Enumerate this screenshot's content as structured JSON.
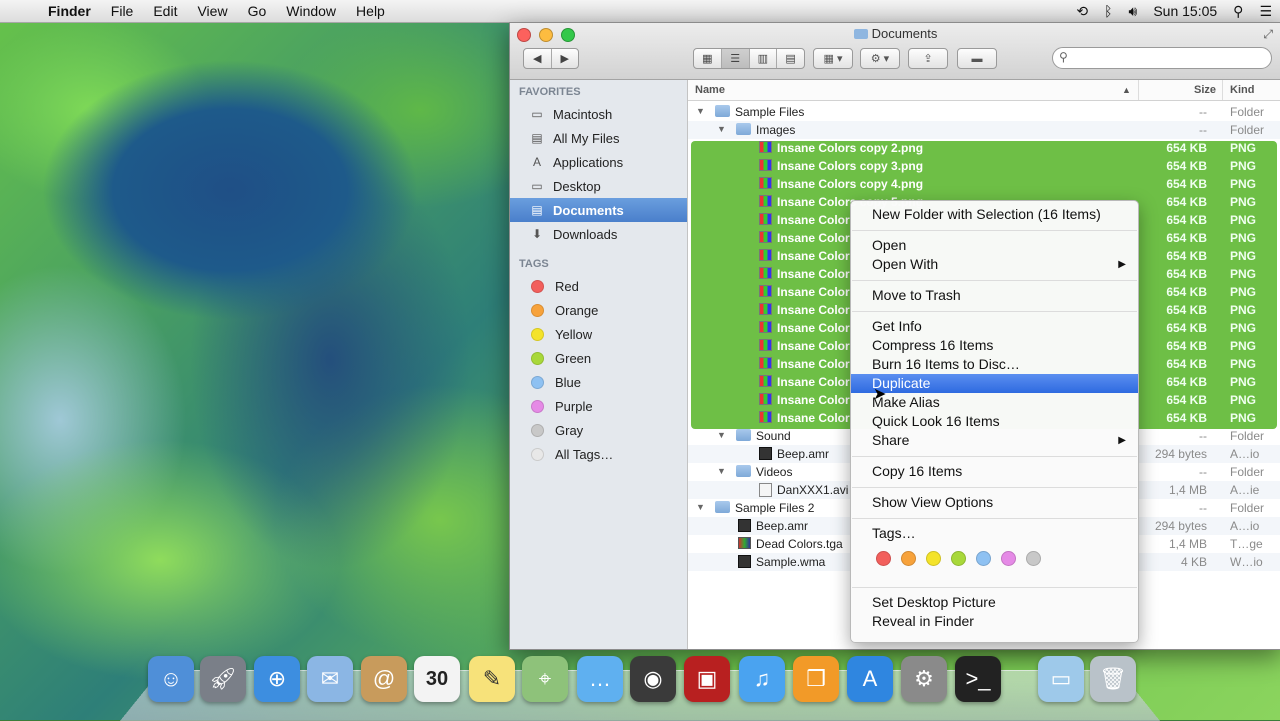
{
  "menubar": {
    "app": "Finder",
    "items": [
      "File",
      "Edit",
      "View",
      "Go",
      "Window",
      "Help"
    ],
    "clock": "Sun 15:05"
  },
  "window": {
    "title": "Documents"
  },
  "sidebar": {
    "favorites_heading": "FAVORITES",
    "favorites": [
      {
        "label": "Macintosh",
        "icon": "hard-drive-icon"
      },
      {
        "label": "All My Files",
        "icon": "all-files-icon"
      },
      {
        "label": "Applications",
        "icon": "applications-icon"
      },
      {
        "label": "Desktop",
        "icon": "desktop-icon"
      },
      {
        "label": "Documents",
        "icon": "documents-icon",
        "selected": true
      },
      {
        "label": "Downloads",
        "icon": "downloads-icon"
      }
    ],
    "tags_heading": "TAGS",
    "tags": [
      {
        "label": "Red",
        "color": "#f25f5c"
      },
      {
        "label": "Orange",
        "color": "#f7a23b"
      },
      {
        "label": "Yellow",
        "color": "#f4e32a"
      },
      {
        "label": "Green",
        "color": "#a8d83a"
      },
      {
        "label": "Blue",
        "color": "#8ec1f2"
      },
      {
        "label": "Purple",
        "color": "#e58ae6"
      },
      {
        "label": "Gray",
        "color": "#c8c8c8"
      },
      {
        "label": "All Tags…",
        "color": "#e8e8e8"
      }
    ]
  },
  "list": {
    "headers": {
      "name": "Name",
      "size": "Size",
      "kind": "Kind"
    },
    "rows": [
      {
        "name": "Sample Files",
        "size": "--",
        "kind": "Folder",
        "type": "folder",
        "level": 0,
        "expanded": true
      },
      {
        "name": "Images",
        "size": "--",
        "kind": "Folder",
        "type": "folder",
        "level": 1,
        "expanded": true
      },
      {
        "name": "Insane Colors copy 2.png",
        "size": "654 KB",
        "kind": "PNG",
        "type": "png",
        "level": 2,
        "selected": true
      },
      {
        "name": "Insane Colors copy 3.png",
        "size": "654 KB",
        "kind": "PNG",
        "type": "png",
        "level": 2,
        "selected": true
      },
      {
        "name": "Insane Colors copy 4.png",
        "size": "654 KB",
        "kind": "PNG",
        "type": "png",
        "level": 2,
        "selected": true
      },
      {
        "name": "Insane Colors copy 5.png",
        "size": "654 KB",
        "kind": "PNG",
        "type": "png",
        "level": 2,
        "selected": true
      },
      {
        "name": "Insane Color",
        "size": "654 KB",
        "kind": "PNG",
        "type": "png",
        "level": 2,
        "selected": true
      },
      {
        "name": "Insane Color",
        "size": "654 KB",
        "kind": "PNG",
        "type": "png",
        "level": 2,
        "selected": true
      },
      {
        "name": "Insane Color",
        "size": "654 KB",
        "kind": "PNG",
        "type": "png",
        "level": 2,
        "selected": true
      },
      {
        "name": "Insane Color",
        "size": "654 KB",
        "kind": "PNG",
        "type": "png",
        "level": 2,
        "selected": true
      },
      {
        "name": "Insane Color",
        "size": "654 KB",
        "kind": "PNG",
        "type": "png",
        "level": 2,
        "selected": true
      },
      {
        "name": "Insane Color",
        "size": "654 KB",
        "kind": "PNG",
        "type": "png",
        "level": 2,
        "selected": true
      },
      {
        "name": "Insane Color",
        "size": "654 KB",
        "kind": "PNG",
        "type": "png",
        "level": 2,
        "selected": true
      },
      {
        "name": "Insane Color",
        "size": "654 KB",
        "kind": "PNG",
        "type": "png",
        "level": 2,
        "selected": true
      },
      {
        "name": "Insane Color",
        "size": "654 KB",
        "kind": "PNG",
        "type": "png",
        "level": 2,
        "selected": true
      },
      {
        "name": "Insane Color",
        "size": "654 KB",
        "kind": "PNG",
        "type": "png",
        "level": 2,
        "selected": true
      },
      {
        "name": "Insane Color",
        "size": "654 KB",
        "kind": "PNG",
        "type": "png",
        "level": 2,
        "selected": true
      },
      {
        "name": "Insane Color",
        "size": "654 KB",
        "kind": "PNG",
        "type": "png",
        "level": 2,
        "selected": true
      },
      {
        "name": "Sound",
        "size": "--",
        "kind": "Folder",
        "type": "folder",
        "level": 1,
        "expanded": true
      },
      {
        "name": "Beep.amr",
        "size": "294 bytes",
        "kind": "A…io",
        "type": "snd",
        "level": 2
      },
      {
        "name": "Videos",
        "size": "--",
        "kind": "Folder",
        "type": "folder",
        "level": 1,
        "expanded": true
      },
      {
        "name": "DanXXX1.avi",
        "size": "1,4 MB",
        "kind": "A…ie",
        "type": "vid",
        "level": 2
      },
      {
        "name": "Sample Files 2",
        "size": "--",
        "kind": "Folder",
        "type": "folder",
        "level": 0,
        "expanded": true
      },
      {
        "name": "Beep.amr",
        "size": "294 bytes",
        "kind": "A…io",
        "type": "snd",
        "level": 1
      },
      {
        "name": "Dead Colors.tga",
        "size": "1,4 MB",
        "kind": "T…ge",
        "type": "tga",
        "level": 1
      },
      {
        "name": "Sample.wma",
        "size": "4 KB",
        "kind": "W…io",
        "type": "snd",
        "level": 1
      }
    ]
  },
  "context_menu": {
    "groups": [
      [
        "New Folder with Selection (16 Items)"
      ],
      [
        "Open",
        "Open With"
      ],
      [
        "Move to Trash"
      ],
      [
        "Get Info",
        "Compress 16 Items",
        "Burn 16 Items to Disc…",
        "Duplicate",
        "Make Alias",
        "Quick Look 16 Items",
        "Share"
      ],
      [
        "Copy 16 Items"
      ],
      [
        "Show View Options"
      ],
      [
        "Tags…"
      ],
      [
        "Set Desktop Picture",
        "Reveal in Finder"
      ]
    ],
    "highlighted": "Duplicate",
    "submenu_items": [
      "Open With",
      "Share"
    ],
    "tag_colors": [
      "#f25f5c",
      "#f7a23b",
      "#f4e32a",
      "#a8d83a",
      "#8ec1f2",
      "#e58ae6",
      "#c8c8c8"
    ]
  },
  "dock": {
    "apps": [
      {
        "name": "finder-icon",
        "color": "#4f8fd8"
      },
      {
        "name": "launchpad-icon",
        "color": "#7a7f88"
      },
      {
        "name": "safari-icon",
        "color": "#3d8ee0"
      },
      {
        "name": "mail-icon",
        "color": "#8bb6e4"
      },
      {
        "name": "contacts-icon",
        "color": "#c89b5c"
      },
      {
        "name": "calendar-icon",
        "color": "#f3f3f3"
      },
      {
        "name": "notes-icon",
        "color": "#f7e27a"
      },
      {
        "name": "maps-icon",
        "color": "#8ec27a"
      },
      {
        "name": "messages-icon",
        "color": "#5fb0f0"
      },
      {
        "name": "facetime-icon",
        "color": "#3a3a3a"
      },
      {
        "name": "photo-booth-icon",
        "color": "#b82020"
      },
      {
        "name": "itunes-icon",
        "color": "#4aa3f0"
      },
      {
        "name": "ibooks-icon",
        "color": "#f29a28"
      },
      {
        "name": "app-store-icon",
        "color": "#2f86e0"
      },
      {
        "name": "system-preferences-icon",
        "color": "#8a8a8a"
      },
      {
        "name": "terminal-icon",
        "color": "#222222"
      },
      {
        "name": "downloads-stack-icon",
        "color": "#9ec9ea"
      },
      {
        "name": "trash-icon",
        "color": "#b9c2c9"
      }
    ],
    "calendar_day": "30"
  }
}
